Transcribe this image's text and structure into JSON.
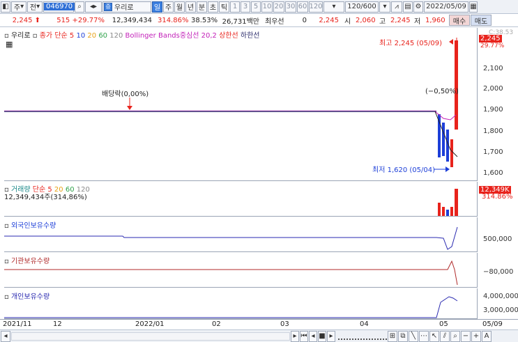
{
  "toolbar": {
    "market": "주",
    "scope": "전",
    "code": "046970",
    "name_badge": "증",
    "name": "우리로",
    "periods": [
      "일",
      "주",
      "월",
      "년",
      "분",
      "초",
      "틱"
    ],
    "minutes": [
      "1",
      "3",
      "5",
      "10",
      "20",
      "30",
      "60",
      "120"
    ],
    "count": "120/600",
    "date": "2022/05/09"
  },
  "quote": {
    "price": "2,245",
    "change": "515",
    "change_pct": "+29.77%",
    "volume": "12,349,434",
    "vol_ratio": "314.86%",
    "turnover": "38.53%",
    "amount": "26,731백만",
    "pref_label": "최우선",
    "pref_value": "0",
    "price2": "2,245",
    "open_label": "시",
    "open": "2,060",
    "high_label": "고",
    "high": "2,245",
    "low_label": "저",
    "low": "1,960",
    "buy": "매수",
    "sell": "매도"
  },
  "price_pane": {
    "legend": {
      "name": "우리로",
      "ma_label": "종가 단순",
      "ma": [
        "5",
        "10",
        "20",
        "60",
        "120"
      ],
      "bb": "Bollinger Bands중심선 20,2",
      "upper": "상한선",
      "lower": "하한선"
    },
    "dividend": "배당락(0,00%)",
    "high_note": "최고 2,245 (05/09)",
    "low_note": "최저 1,620 (05/04)",
    "pct_note": "(−0,50%)",
    "y_ticks": [
      "2,100",
      "2,000",
      "1,900",
      "1,800",
      "1,700",
      "1,600"
    ],
    "current": "2,245",
    "current_pct": "29.77%",
    "top_label": "C:38.53"
  },
  "volume_pane": {
    "title": "거래량",
    "ma_label": "단순",
    "ma": [
      "5",
      "20",
      "60",
      "120"
    ],
    "value": "12,349,434주(314,86%)",
    "badge": "12,349K",
    "badge_pct": "314.86%"
  },
  "foreign_pane": {
    "title": "외국인보유수량",
    "tick": "500,000"
  },
  "inst_pane": {
    "title": "기관보유수량",
    "tick": "−80,000"
  },
  "indiv_pane": {
    "title": "개인보유수량",
    "ticks": [
      "4,000,000",
      "3,000,000"
    ]
  },
  "x_axis": [
    "2021/11",
    "12",
    "2022/01",
    "02",
    "03",
    "04",
    "05",
    "05/09"
  ],
  "colors": {
    "up": "#e8231c",
    "down": "#1d3fd8",
    "ma5": "#e8231c",
    "ma10": "#1d3fd8",
    "ma20": "#e8a317",
    "ma60": "#2fa24a",
    "ma120": "#8a8a8a",
    "bb": "#c21fb8"
  }
}
